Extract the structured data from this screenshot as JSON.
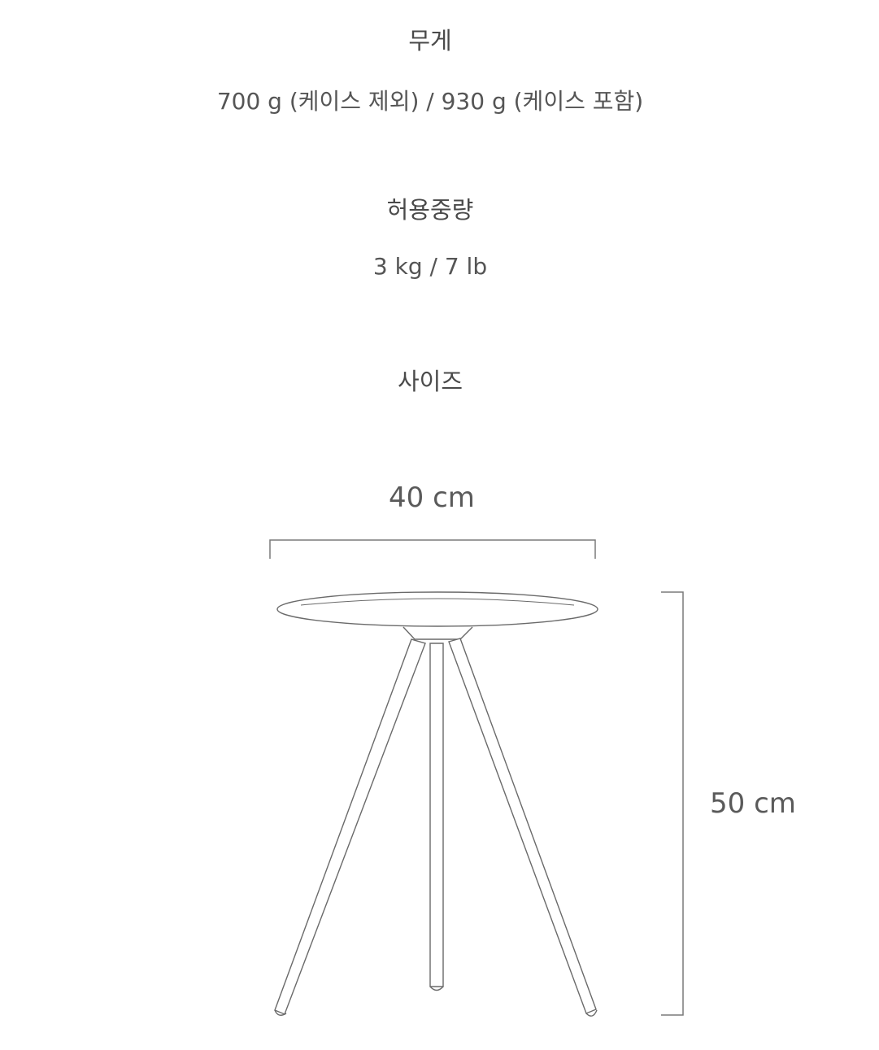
{
  "specs": {
    "weight": {
      "heading": "무게",
      "value": "700 g (케이스 제외) / 930 g (케이스 포함)"
    },
    "load": {
      "heading": "허용중량",
      "value": "3 kg / 7 lb"
    },
    "size": {
      "heading": "사이즈"
    }
  },
  "diagram": {
    "width_label": "40 cm",
    "height_label": "50 cm"
  },
  "colors": {
    "text": "#555555",
    "line": "#7a7a7a"
  }
}
